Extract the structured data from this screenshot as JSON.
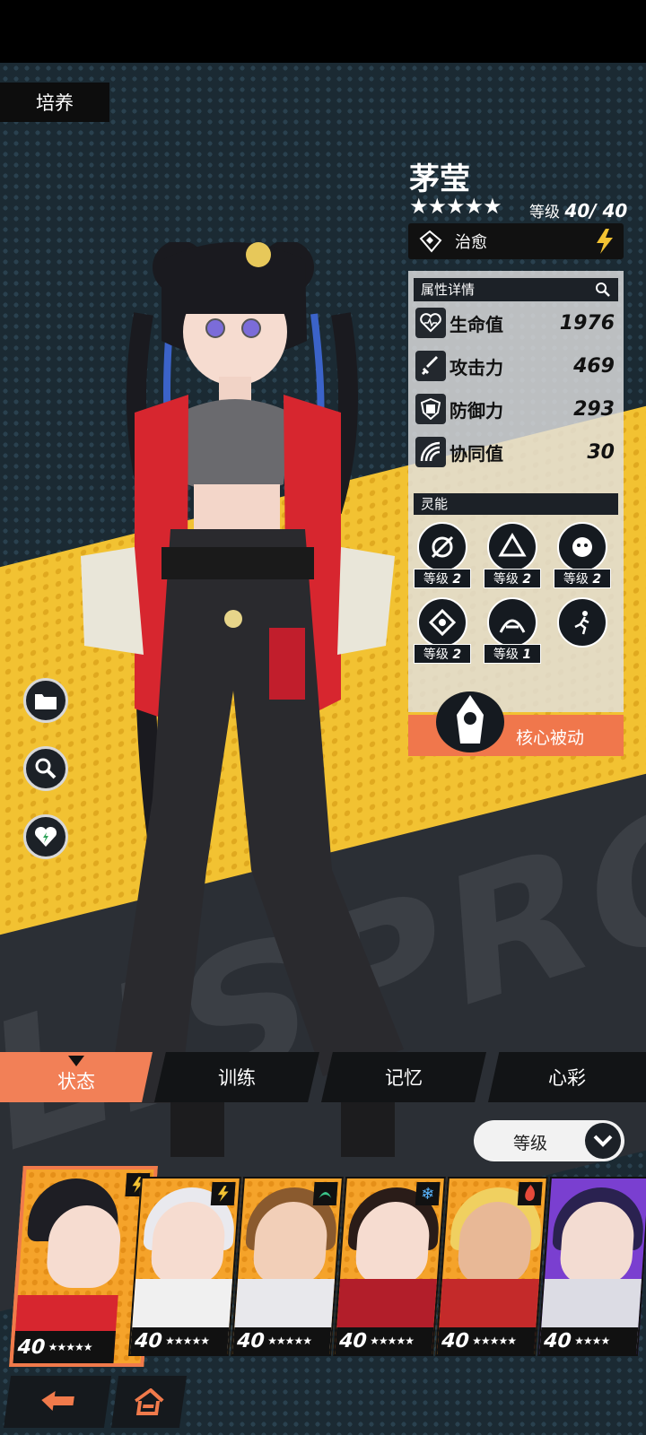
{
  "header": {
    "section_tag": "培养"
  },
  "character": {
    "name": "茅莹",
    "stars": "★★★★★",
    "level_label": "等级",
    "level_value": "40/ 40",
    "class_name": "治愈"
  },
  "attributes": {
    "title": "属性详情",
    "rows": [
      {
        "icon": "heart-icon",
        "label": "生命值",
        "value": "1976"
      },
      {
        "icon": "sword-icon",
        "label": "攻击力",
        "value": "469"
      },
      {
        "icon": "shield-icon",
        "label": "防御力",
        "value": "293"
      },
      {
        "icon": "synergy-icon",
        "label": "协同值",
        "value": "30"
      }
    ]
  },
  "psi": {
    "title": "灵能",
    "skills": [
      {
        "level_label": "等级",
        "level": "2"
      },
      {
        "level_label": "等级",
        "level": "2"
      },
      {
        "level_label": "等级",
        "level": "2"
      },
      {
        "level_label": "等级",
        "level": "2"
      },
      {
        "level_label": "等级",
        "level": "1"
      }
    ]
  },
  "core_passive": {
    "label": "核心被动"
  },
  "tabs": [
    {
      "label": "状态",
      "active": true
    },
    {
      "label": "训练",
      "active": false
    },
    {
      "label": "记忆",
      "active": false
    },
    {
      "label": "心彩",
      "active": false
    }
  ],
  "sort": {
    "label": "等级"
  },
  "roster": [
    {
      "level": "40",
      "stars": "★★★★★",
      "element": "lightning",
      "selected": true
    },
    {
      "level": "40",
      "stars": "★★★★★",
      "element": "lightning"
    },
    {
      "level": "40",
      "stars": "★★★★★",
      "element": "wind"
    },
    {
      "level": "40",
      "stars": "★★★★★",
      "element": "ice"
    },
    {
      "level": "40",
      "stars": "★★★★★",
      "element": "fire"
    },
    {
      "level": "40",
      "stars": "★★★★"
    }
  ],
  "colors": {
    "accent": "#f07a4b",
    "yellow": "#f2c232",
    "panel_dark": "#1c2127"
  }
}
